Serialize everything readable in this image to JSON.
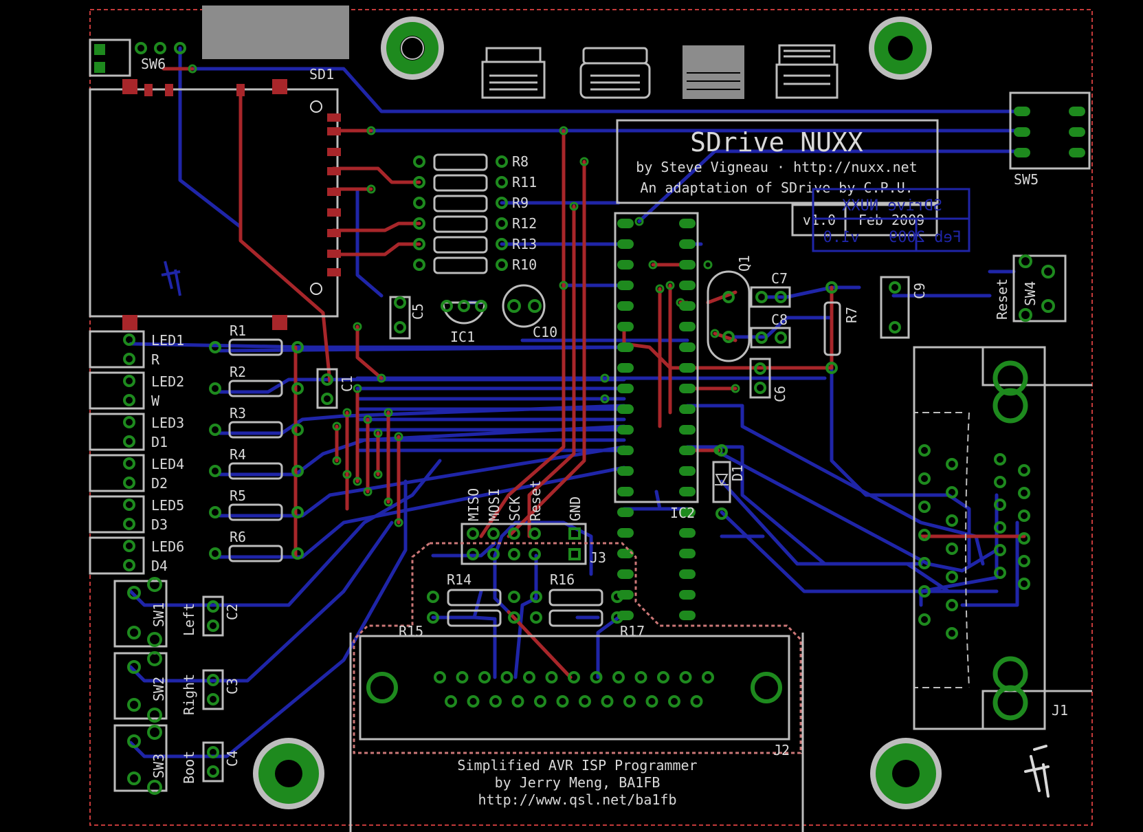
{
  "title_block": {
    "title": "SDrive NUXX",
    "author_line": "by Steve Vigneau · http://nuxx.net",
    "adaptation_line": "An adaptation of SDrive by C.P.U.",
    "version": "v1.0",
    "date": "Feb 2009"
  },
  "programmer": {
    "line1": "Simplified AVR ISP Programmer",
    "line2": "by Jerry Meng, BA1FB",
    "line3": "http://www.qsl.net/ba1fb"
  },
  "labels": {
    "sw6": "SW6",
    "sd1": "SD1",
    "sw5": "SW5",
    "sw4": "SW4",
    "reset": "Reset",
    "r8": "R8",
    "r11": "R11",
    "r9": "R9",
    "r12": "R12",
    "r13": "R13",
    "r10": "R10",
    "c5": "C5",
    "ic1": "IC1",
    "c10": "C10",
    "q1": "Q1",
    "c7": "C7",
    "c8": "C8",
    "c6": "C6",
    "r7": "R7",
    "c9": "C9",
    "c1": "C1",
    "ic2": "IC2",
    "d1": "D1",
    "j3": "J3",
    "isp_miso": "MISO",
    "isp_mosi": "MOSI",
    "isp_sck": "SCK",
    "isp_reset": "Reset",
    "isp_gnd": "GND",
    "r14": "R14",
    "r15": "R15",
    "r16": "R16",
    "r17": "R17",
    "j2": "J2",
    "j1": "J1",
    "sw1": "SW1",
    "sw2": "SW2",
    "sw3": "SW3",
    "left": "Left",
    "right": "Right",
    "boot": "Boot",
    "c2": "C2",
    "c3": "C3",
    "c4": "C4"
  },
  "leds": [
    {
      "led": "LED1",
      "color": "R",
      "res": "R1"
    },
    {
      "led": "LED2",
      "color": "W",
      "res": "R2"
    },
    {
      "led": "LED3",
      "color": "D1",
      "res": "R3"
    },
    {
      "led": "LED4",
      "color": "D2",
      "res": "R4"
    },
    {
      "led": "LED5",
      "color": "D3",
      "res": "R5"
    },
    {
      "led": "LED6",
      "color": "D4",
      "res": "R6"
    }
  ],
  "colors": {
    "board_bg": "#000000",
    "bottom_copper": "#1f25a8",
    "top_copper": "#a8262a",
    "pads": "#1e8a1e",
    "silkscreen": "#bdbdbd"
  }
}
